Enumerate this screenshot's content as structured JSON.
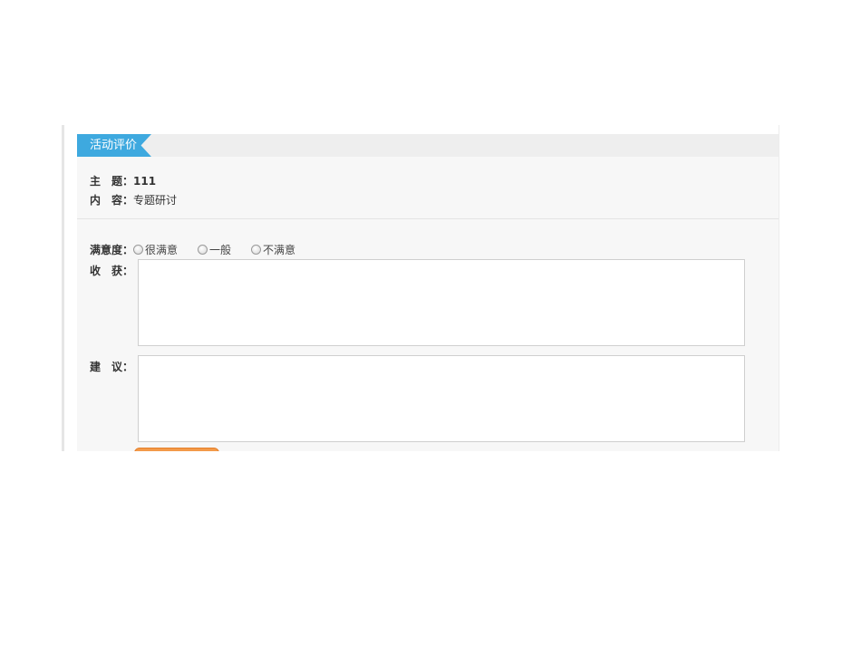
{
  "panel": {
    "tab_title": "活动评价"
  },
  "info": {
    "subject_label": "主　题：",
    "subject_value": "111",
    "content_label": "内　容：",
    "content_value": "专题研讨"
  },
  "satisfaction": {
    "label": "满意度：",
    "options": [
      "很满意",
      "一般",
      "不满意"
    ]
  },
  "gains": {
    "label": "收　获：",
    "value": ""
  },
  "suggestion": {
    "label": "建　议：",
    "value": ""
  },
  "colors": {
    "tab_bg": "#3ea9df",
    "panel_bg": "#f7f7f7",
    "header_bg": "#eeeeee",
    "button_accent": "#f39a4a"
  }
}
